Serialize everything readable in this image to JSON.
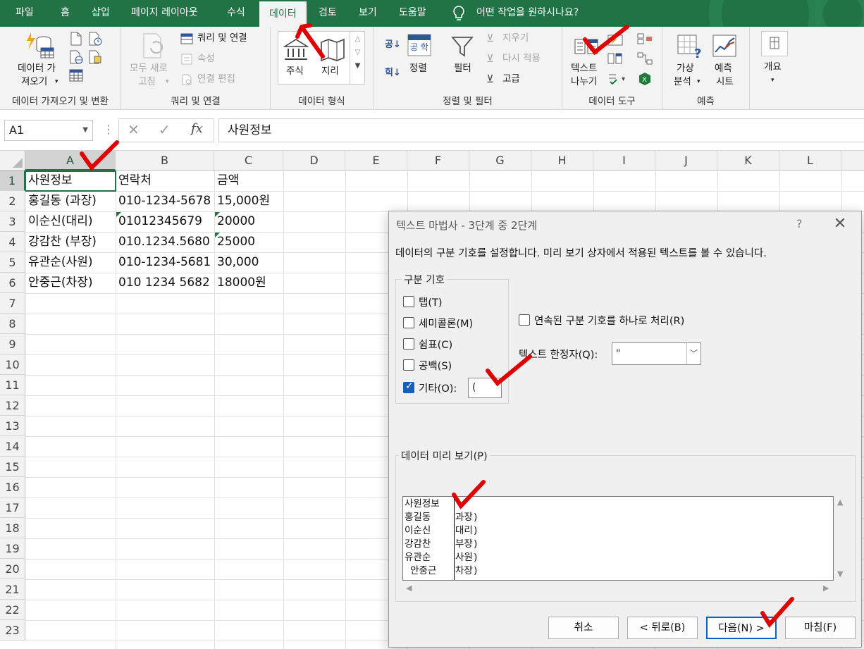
{
  "tabs": [
    "파일",
    "홈",
    "삽입",
    "페이지 레이아웃",
    "수식",
    "데이터",
    "검토",
    "보기",
    "도움말"
  ],
  "active_tab": "데이터",
  "tell_me": "어떤 작업을 원하시나요?",
  "ribbon": {
    "get_data_1": "데이터 가",
    "get_data_2": "져오기",
    "group_get": "데이터 가져오기 및 변환",
    "refresh_1": "모두 새로",
    "refresh_2": "고침",
    "queries": "쿼리 및 연결",
    "properties": "속성",
    "edit_links": "연결 편집",
    "group_queries": "쿼리 및 연결",
    "stocks": "주식",
    "geography": "지리",
    "group_types": "데이터 형식",
    "sort": "정렬",
    "filter": "필터",
    "clear": "지우기",
    "reapply": "다시 적용",
    "advanced": "고급",
    "group_sort": "정렬 및 필터",
    "text_to_cols_1": "텍스트",
    "text_to_cols_2": "나누기",
    "group_tools": "데이터 도구",
    "what_if_1": "가상",
    "what_if_2": "분석",
    "forecast_1": "예측",
    "forecast_2": "시트",
    "group_forecast": "예측",
    "outline": "개요"
  },
  "formula": {
    "name_box": "A1",
    "value": "사원정보"
  },
  "columns": [
    "A",
    "B",
    "C",
    "D",
    "E",
    "F",
    "G",
    "H",
    "I",
    "J",
    "K",
    "L"
  ],
  "rows": [
    "1",
    "2",
    "3",
    "4",
    "5",
    "6",
    "7",
    "8",
    "9",
    "10",
    "11",
    "12",
    "13",
    "14",
    "15",
    "16",
    "17",
    "18",
    "19",
    "20",
    "21",
    "22",
    "23"
  ],
  "cells": {
    "a": [
      "사원정보",
      "홍길동 (과장)",
      "이순신(대리)",
      "강감찬  (부장)",
      "유관순(사원)",
      " 안중근(차장)"
    ],
    "b": [
      "연락처",
      "010-1234-5678",
      "01012345679",
      "010.1234.5680",
      "010-1234-5681",
      "010 1234 5682"
    ],
    "c": [
      "금액",
      " 15,000원",
      "20000",
      " 25000",
      "30,000",
      "18000원"
    ]
  },
  "dialog": {
    "title": "텍스트 마법사 - 3단계 중 2단계",
    "help": "?",
    "close": "✕",
    "description": "데이터의 구분 기호를 설정합니다. 미리 보기 상자에서 적용된 텍스트를 볼 수 있습니다.",
    "delimiters_legend": "구분 기호",
    "tab": "탭(T)",
    "semicolon": "세미콜론(M)",
    "comma": "쉼표(C)",
    "space": "공백(S)",
    "other": "기타(O):",
    "other_value": "(",
    "consecutive": "연속된 구분 기호를 하나로 처리(R)",
    "qualifier_label": "텍스트 한정자(Q):",
    "qualifier_value": "\"",
    "preview_legend": "데이터 미리 보기(P)",
    "preview_rows": [
      [
        "사원정보",
        ""
      ],
      [
        "홍길동 ",
        "과장)"
      ],
      [
        "이순신",
        "대리)"
      ],
      [
        "강감찬  ",
        "부장)"
      ],
      [
        "유관순",
        "사원)"
      ],
      [
        " 안중근",
        "차장)"
      ]
    ],
    "cancel": "취소",
    "back": "< 뒤로(B)",
    "next": "다음(N) >",
    "finish": "마침(F)"
  },
  "colors": {
    "accent": "#217346",
    "annotation": "#e00000"
  }
}
